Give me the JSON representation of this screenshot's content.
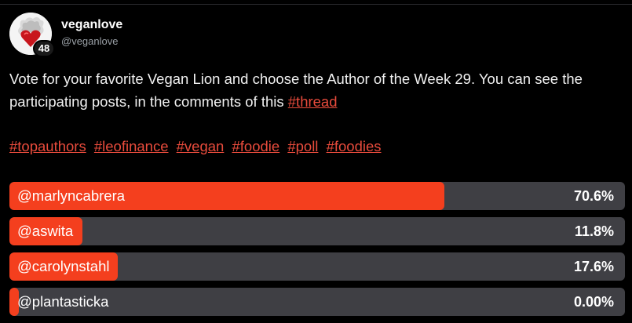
{
  "author": {
    "display_name": "veganlove",
    "handle": "@veganlove",
    "level": "48"
  },
  "post": {
    "text_before": "Vote for your favorite Vegan Lion and choose the Author of the Week 29. You can see the participating posts, in the comments of this ",
    "thread_link": "#thread",
    "tags": [
      "#topauthors",
      "#leofinance",
      "#vegan",
      "#foodie",
      "#poll",
      "#foodies"
    ]
  },
  "poll": {
    "options": [
      {
        "label": "@marlyncabrera",
        "percent_text": "70.6%",
        "percent": 70.6
      },
      {
        "label": "@aswita",
        "percent_text": "11.8%",
        "percent": 11.8
      },
      {
        "label": "@carolynstahl",
        "percent_text": "17.6%",
        "percent": 17.6
      },
      {
        "label": "@plantasticka",
        "percent_text": "0.00%",
        "percent": 0
      }
    ]
  },
  "colors": {
    "accent": "#f43f1e",
    "link": "#e84b3c",
    "bar_track": "#3f3f44",
    "background": "#000000"
  }
}
